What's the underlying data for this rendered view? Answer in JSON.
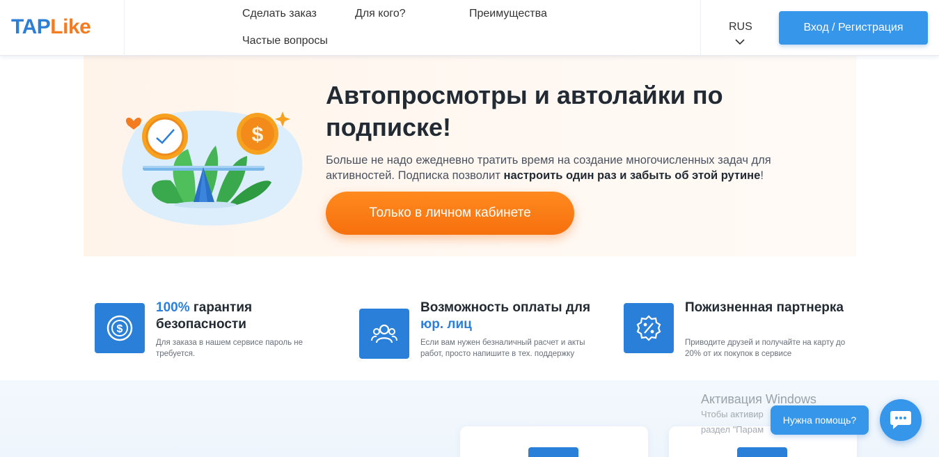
{
  "brand": {
    "tap": "TAP",
    "like": "Like"
  },
  "nav": {
    "items": [
      {
        "label": "Сделать заказ"
      },
      {
        "label": "Для кого?"
      },
      {
        "label": "Преимущества"
      },
      {
        "label": "Частые вопросы"
      }
    ],
    "language": "RUS",
    "login_label": "Вход / Регистрация"
  },
  "hero": {
    "title": "Автопросмотры и автолайки по подписке!",
    "text_before": "Больше не надо ежедневно тратить время на создание многочисленных задач для активностей. Подписка позволит ",
    "text_bold": "настроить один раз и забыть об этой рутине",
    "text_after": "!",
    "cta_label": "Только в личном кабинете"
  },
  "features": [
    {
      "icon": "dollar-circle-icon",
      "title_accent": "100%",
      "title_rest": " гарантия безопасности",
      "desc": "Для заказа в нашем сервисе пароль не требуется."
    },
    {
      "icon": "users-icon",
      "title_rest": "Возможность оплаты для ",
      "title_accent": "юр. лиц",
      "desc": "Если вам нужен безналичный расчет и акты работ, просто напишите в тех. поддержку"
    },
    {
      "icon": "percent-badge-icon",
      "title_rest": "Пожизненная партнерка",
      "desc": "Приводите друзей и получайте на карту до 20% от их покупок в сервисе"
    }
  ],
  "watermark": {
    "title": "Активация Windows",
    "line1": "Чтобы активир",
    "line2": "раздел \"Парам"
  },
  "help": {
    "label": "Нужна помощь?"
  },
  "colors": {
    "accent_blue": "#2a7fd8",
    "button_blue": "#3596ea",
    "accent_orange": "#f47b20"
  }
}
